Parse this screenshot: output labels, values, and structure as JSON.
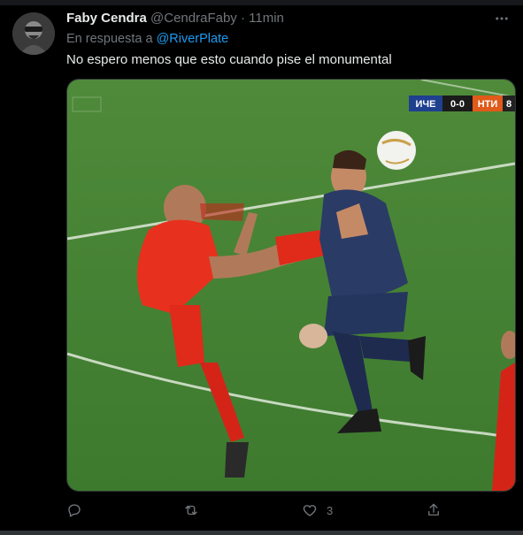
{
  "tweet": {
    "author_name": "Faby Cendra",
    "author_handle": "@CendraFaby",
    "separator": "·",
    "time": "11min",
    "reply_prefix": "En respuesta a",
    "reply_to": "@RiverPlate",
    "text": "No espero menos que esto cuando pise el monumental",
    "media": {
      "scoreboard_left": "ИЧЕ",
      "scoreboard_score": "0-0",
      "scoreboard_right": "НТИ",
      "scoreboard_extra": "8"
    },
    "actions": {
      "reply_icon": "reply-icon",
      "retweet_icon": "retweet-icon",
      "like_icon": "like-icon",
      "like_count": "3",
      "share_icon": "share-icon"
    }
  },
  "colors": {
    "background": "#000000",
    "text_primary": "#e7e9ea",
    "text_secondary": "#71767b",
    "link": "#1d9bf0"
  }
}
